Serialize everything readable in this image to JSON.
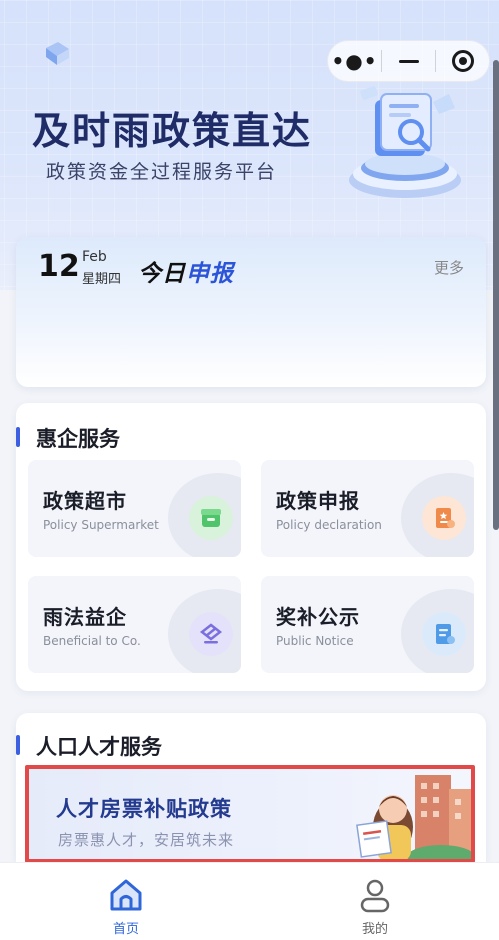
{
  "header": {
    "title": "及时雨政策直达",
    "subtitle": "政策资金全过程服务平台",
    "capsule": {
      "more_icon": "more-dots-icon",
      "minimize_icon": "minimize-icon",
      "close_icon": "target-close-icon"
    }
  },
  "today": {
    "day": "12",
    "month": "Feb",
    "weekday": "星期四",
    "title_part1": "今日",
    "title_part2": "申报",
    "more": "更多"
  },
  "enterprise_services": {
    "section_title": "惠企服务",
    "tiles": [
      {
        "title": "政策超市",
        "subtitle": "Policy Supermarket",
        "icon": "store-icon",
        "color": "#4fc46a"
      },
      {
        "title": "政策申报",
        "subtitle": "Policy declaration",
        "icon": "declaration-doc-icon",
        "color": "#ef8a4a"
      },
      {
        "title": "雨法益企",
        "subtitle": "Beneficial to Co.",
        "icon": "law-icon",
        "color": "#7b6fe0"
      },
      {
        "title": "奖补公示",
        "subtitle": "Public Notice",
        "icon": "notice-doc-icon",
        "color": "#4f9be8"
      }
    ]
  },
  "talent_services": {
    "section_title": "人口人才服务",
    "banner_title": "人才房票补贴政策",
    "banner_subtitle": "房票惠人才，安居筑未来"
  },
  "tabbar": {
    "items": [
      {
        "label": "首页",
        "icon": "home-icon",
        "active": true
      },
      {
        "label": "我的",
        "icon": "user-icon",
        "active": false
      }
    ],
    "active_color": "#2f66d8",
    "inactive_color": "#666666"
  },
  "colors": {
    "accent": "#3b5fe0",
    "title_navy": "#1f2c67",
    "highlight_border": "#e24a4a"
  }
}
